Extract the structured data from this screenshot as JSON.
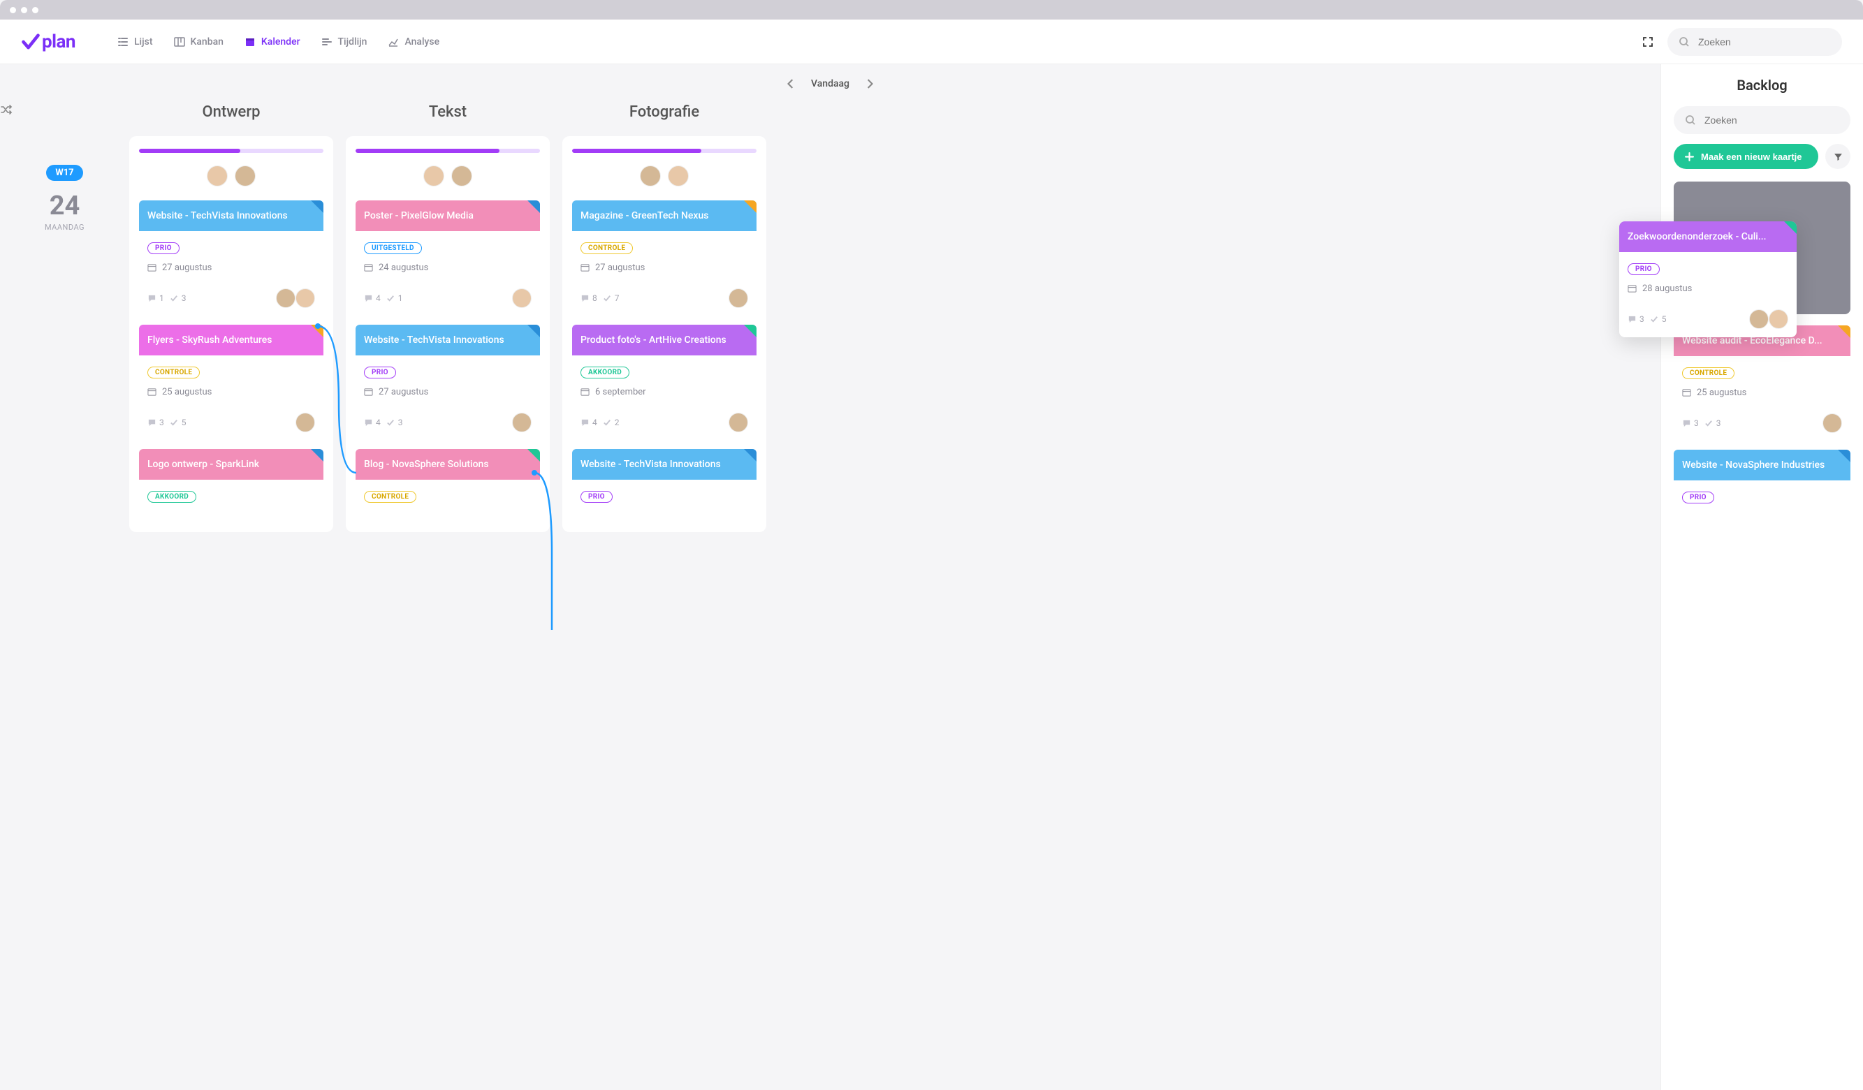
{
  "nav": {
    "list": "Lijst",
    "kanban": "Kanban",
    "calendar": "Kalender",
    "timeline": "Tijdlijn",
    "analyse": "Analyse",
    "search_placeholder": "Zoeken"
  },
  "datebar": {
    "today": "Vandaag"
  },
  "datecol": {
    "week": "W17",
    "day_num": "24",
    "day_name": "MAANDAG"
  },
  "columns": {
    "ontwerp": {
      "title": "Ontwerp",
      "progress": 55
    },
    "tekst": {
      "title": "Tekst",
      "progress": 78
    },
    "fotografie": {
      "title": "Fotografie",
      "progress": 70
    }
  },
  "cards": {
    "o1": {
      "title": "Website - TechVista Innovations",
      "chip": "PRIO",
      "date": "27 augustus",
      "comments": "1",
      "checks": "3"
    },
    "o2": {
      "title": "Flyers - SkyRush Adventures",
      "chip": "CONTROLE",
      "date": "25 augustus",
      "comments": "3",
      "checks": "5"
    },
    "o3": {
      "title": "Logo ontwerp - SparkLink",
      "chip": "AKKOORD"
    },
    "t1": {
      "title": "Poster - PixelGlow Media",
      "chip": "UITGESTELD",
      "date": "24 augustus",
      "comments": "4",
      "checks": "1"
    },
    "t2": {
      "title": "Website - TechVista Innovations",
      "chip": "PRIO",
      "date": "27 augustus",
      "comments": "4",
      "checks": "3"
    },
    "t3": {
      "title": "Blog - NovaSphere Solutions",
      "chip": "CONTROLE"
    },
    "f1": {
      "title": "Magazine - GreenTech Nexus",
      "chip": "CONTROLE",
      "date": "27 augustus",
      "comments": "8",
      "checks": "7"
    },
    "f2": {
      "title": "Product foto's - ArtHive Creations",
      "chip": "AKKOORD",
      "date": "6 september",
      "comments": "4",
      "checks": "2"
    },
    "f3": {
      "title": "Website - TechVista Innovations",
      "chip": "PRIO"
    }
  },
  "backlog": {
    "title": "Backlog",
    "search_placeholder": "Zoeken",
    "new_card": "Maak een nieuw kaartje",
    "floating": {
      "title": "Zoekwoordenonderzoek - Culi...",
      "chip": "PRIO",
      "date": "28 augustus",
      "comments": "3",
      "checks": "5"
    },
    "b1": {
      "title": "Website audit -  EcoElegance D...",
      "chip": "CONTROLE",
      "date": "25 augustus",
      "comments": "3",
      "checks": "3"
    },
    "b2": {
      "title": "Website - NovaSphere Industries",
      "chip": "PRIO"
    }
  }
}
